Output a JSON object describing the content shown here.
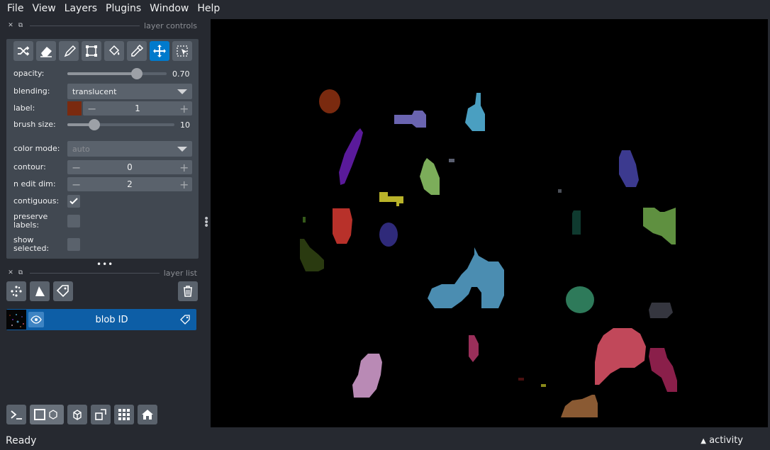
{
  "menu": [
    "File",
    "View",
    "Layers",
    "Plugins",
    "Window",
    "Help"
  ],
  "layer_controls": {
    "title": "layer controls",
    "tools": [
      "shuffle-icon",
      "eraser-icon",
      "paintbrush-icon",
      "polygon-icon",
      "fill-bucket-icon",
      "color-picker-icon",
      "move-icon",
      "transform-icon"
    ],
    "active_tool": "move-icon",
    "opacity": {
      "label": "opacity:",
      "value": 0.7,
      "display": "0.70"
    },
    "blending": {
      "label": "blending:",
      "value": "translucent"
    },
    "label": {
      "label": "label:",
      "value": "1",
      "color": "#7a2a0f"
    },
    "brush_size": {
      "label": "brush size:",
      "value": 10,
      "max": 40,
      "display": "10"
    },
    "color_mode": {
      "label": "color mode:",
      "value": "auto"
    },
    "contour": {
      "label": "contour:",
      "value": "0"
    },
    "n_edit_dim": {
      "label": "n edit dim:",
      "value": "2"
    },
    "contiguous": {
      "label": "contiguous:",
      "checked": true
    },
    "preserve_labels": {
      "label": "preserve\nlabels:",
      "line1": "preserve",
      "line2": "labels:",
      "checked": false
    },
    "show_selected": {
      "label": "show\nselected:",
      "line1": "show",
      "line2": "selected:",
      "checked": false
    }
  },
  "layer_list": {
    "title": "layer list",
    "buttons": [
      "points-icon",
      "shapes-icon",
      "labels-icon"
    ],
    "delete": "trash-icon",
    "layers": [
      {
        "name": "blob ID",
        "visible": true,
        "type": "labels-icon"
      }
    ]
  },
  "bottom_buttons": [
    "console-icon",
    "ndisplay-icon",
    "roll-icon",
    "transpose-icon",
    "grid-icon",
    "home-icon"
  ],
  "status": {
    "text": "Ready",
    "activity": "activity"
  },
  "colors": {
    "accent": "#007acc",
    "selected_layer": "#0d5ea6",
    "panel": "#414851",
    "background": "#262930"
  }
}
